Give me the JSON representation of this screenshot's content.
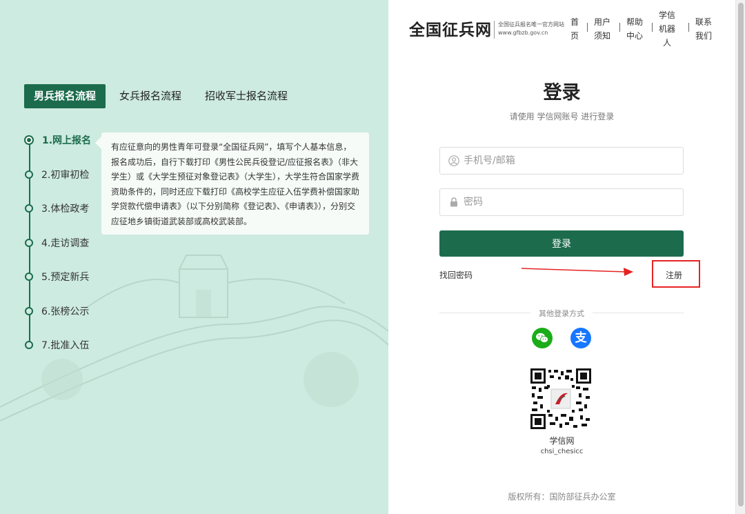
{
  "left": {
    "tabs": [
      "男兵报名流程",
      "女兵报名流程",
      "招收军士报名流程"
    ],
    "steps": [
      "1.网上报名",
      "2.初审初检",
      "3.体检政考",
      "4.走访调查",
      "5.预定新兵",
      "6.张榜公示",
      "7.批准入伍"
    ],
    "bubble_text": "有应征意向的男性青年可登录“全国征兵网”，填写个人基本信息，报名成功后，自行下载打印《男性公民兵役登记/应征报名表》（非大学生）或《大学生预征对象登记表》（大学生），大学生符合国家学费资助条件的，同时还应下载打印《高校学生应征入伍学费补偿国家助学贷款代偿申请表》（以下分别简称《登记表》、《申请表》），分别交应征地乡镇街道武装部或高校武装部。"
  },
  "header": {
    "logo": "全国征兵网",
    "logo_sub1": "全国征兵报名唯一官方网站",
    "logo_sub2": "www.gfbzb.gov.cn",
    "nav": [
      {
        "l1": "首",
        "l2": "页"
      },
      {
        "l1": "用户",
        "l2": "须知"
      },
      {
        "l1": "帮助",
        "l2": "中心"
      },
      {
        "l1": "学信",
        "l2": "机器",
        "l3": "人"
      },
      {
        "l1": "联系",
        "l2": "我们"
      }
    ]
  },
  "login": {
    "title": "登录",
    "subtitle": "请使用 学信网账号 进行登录",
    "username_placeholder": "手机号/邮箱",
    "password_placeholder": "密码",
    "button": "登录",
    "forgot": "找回密码",
    "register": "注册",
    "other": "其他登录方式",
    "wechat_icon": "wechat-icon",
    "alipay_icon": "alipay-icon",
    "alipay_glyph": "支",
    "qr_label": "学信网",
    "qr_sub": "chsi_chesicc",
    "copyright": "版权所有：国防部征兵办公室"
  },
  "colors": {
    "primary": "#1c6b4d",
    "left_bg": "#cdebe0",
    "annotation_red": "#e62222",
    "wechat": "#1aad19",
    "alipay": "#1677ff"
  }
}
